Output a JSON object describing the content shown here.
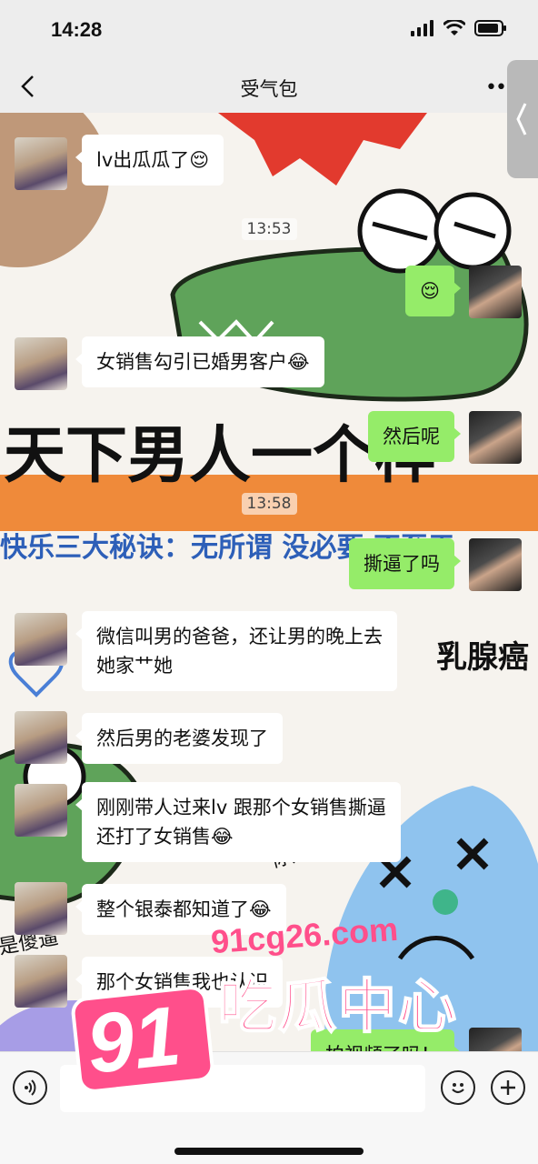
{
  "status_bar": {
    "time": "14:28"
  },
  "nav": {
    "title": "受气包",
    "more": "••"
  },
  "background_texts": {
    "banner": "天下男人一个样",
    "subtitle": "快乐三大秘诀：无所谓 没必要 不至于",
    "side": "乳腺癌",
    "small_a": "你是傻逼",
    "small_b": "是傻逼"
  },
  "messages": [
    {
      "side": "left",
      "text": "lv出瓜瓜了😌"
    },
    {
      "timestamp": "13:53"
    },
    {
      "side": "right",
      "text": "😌"
    },
    {
      "side": "left",
      "text": "女销售勾引已婚男客户😂"
    },
    {
      "side": "right",
      "text": "然后呢"
    },
    {
      "timestamp": "13:58"
    },
    {
      "side": "right",
      "text": "撕逼了吗"
    },
    {
      "side": "left",
      "text": "微信叫男的爸爸，还让男的晚上去\n她家艹她"
    },
    {
      "side": "left",
      "text": "然后男的老婆发现了"
    },
    {
      "side": "left",
      "text": "刚刚带人过来lv 跟那个女销售撕逼\n还打了女销售😂"
    },
    {
      "side": "left",
      "text": "整个银泰都知道了😂"
    },
    {
      "side": "left",
      "text": "那个女销售我也认识"
    },
    {
      "side": "right",
      "text": "拍视频了吗！"
    }
  ],
  "watermark": {
    "domain": "91cg26.com",
    "name": "吃瓜中心",
    "logo": "91"
  },
  "colors": {
    "bubble_right": "#95ec69",
    "bubble_left": "#ffffff",
    "watermark": "#ff4f8b"
  }
}
